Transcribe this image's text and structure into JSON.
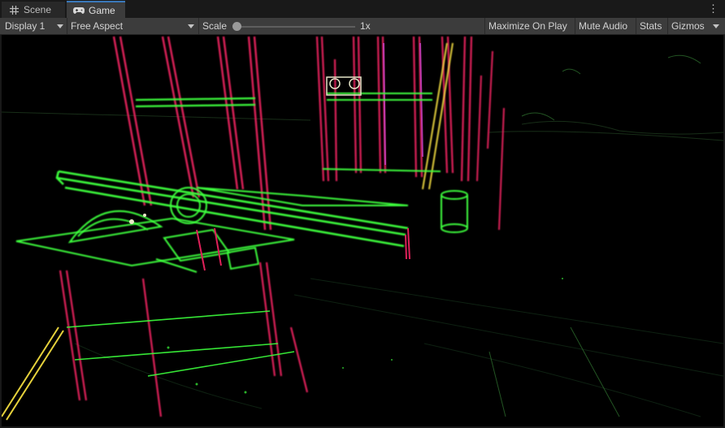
{
  "tabs": [
    {
      "label": "Scene",
      "icon": "grid-icon"
    },
    {
      "label": "Game",
      "icon": "gamepad-icon"
    }
  ],
  "toolbar": {
    "display": "Display 1",
    "aspect": "Free Aspect",
    "scale_label": "Scale",
    "scale_value": "1x",
    "scale_fraction": 0.0,
    "maximize": "Maximize On Play",
    "mute": "Mute Audio",
    "stats": "Stats",
    "gizmos": "Gizmos"
  },
  "colors": {
    "edge_red": "#e0205a",
    "edge_green": "#3cff3c",
    "edge_yellow": "#e6d23c",
    "accent": "#3a79bb"
  }
}
